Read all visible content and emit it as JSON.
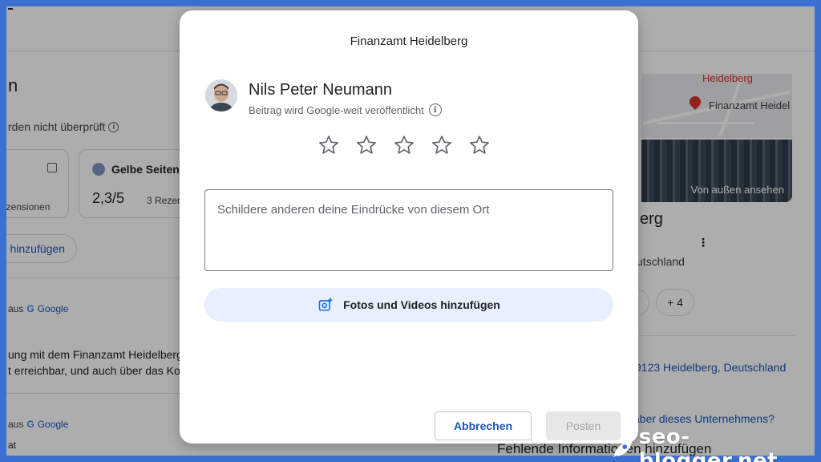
{
  "background": {
    "heading_fragment": "n",
    "note_fragment": "rden nicht überprüft",
    "card1": {
      "reviews_fragment": "ezensionen"
    },
    "card2": {
      "name": "Gelbe Seiten",
      "score": "2,3/5",
      "count_fragment": "3 Rezen"
    },
    "add_button_fragment": "hinzufügen",
    "source1": {
      "prefix": "aus",
      "g": "G",
      "brand": "Google"
    },
    "text_line1": "ung mit dem Finanzamt Heidelberg",
    "text_line2": "t erreichbar, und auch über das Ko",
    "source2": {
      "prefix": "aus",
      "g": "G",
      "brand": "Google"
    },
    "text_line3": "at",
    "map": {
      "label_top": "Heidelberg",
      "pin_label": "Finanzamt Heidel"
    },
    "photo_label": "Von außen ansehen",
    "right_title_fragment": "erg",
    "right_address_fragment": "utschland",
    "chip_plus": "+ 4",
    "right_address_full_fragment": "9123 Heidelberg, Deutschland",
    "right_question_fragment": "aber dieses Unternehmens?",
    "right_footer": "Fehlende Informationen hinzufügen"
  },
  "modal": {
    "title": "Finanzamt Heidelberg",
    "user_name": "Nils Peter Neumann",
    "publish_note": "Beitrag wird Google-weit veröffentlicht",
    "rating": {
      "max": 5,
      "value": 0
    },
    "review_placeholder": "Schildere anderen deine Eindrücke von diesem Ort",
    "add_media_label": "Fotos und Videos hinzufügen",
    "cancel_label": "Abbrechen",
    "post_label": "Posten"
  },
  "watermark": {
    "text": "seo-blogger.net"
  },
  "colors": {
    "frame": "#3d6fd0",
    "accent": "#1a56b8",
    "media_button_bg": "#e8f0fe",
    "star_outline": "#5f6368"
  }
}
